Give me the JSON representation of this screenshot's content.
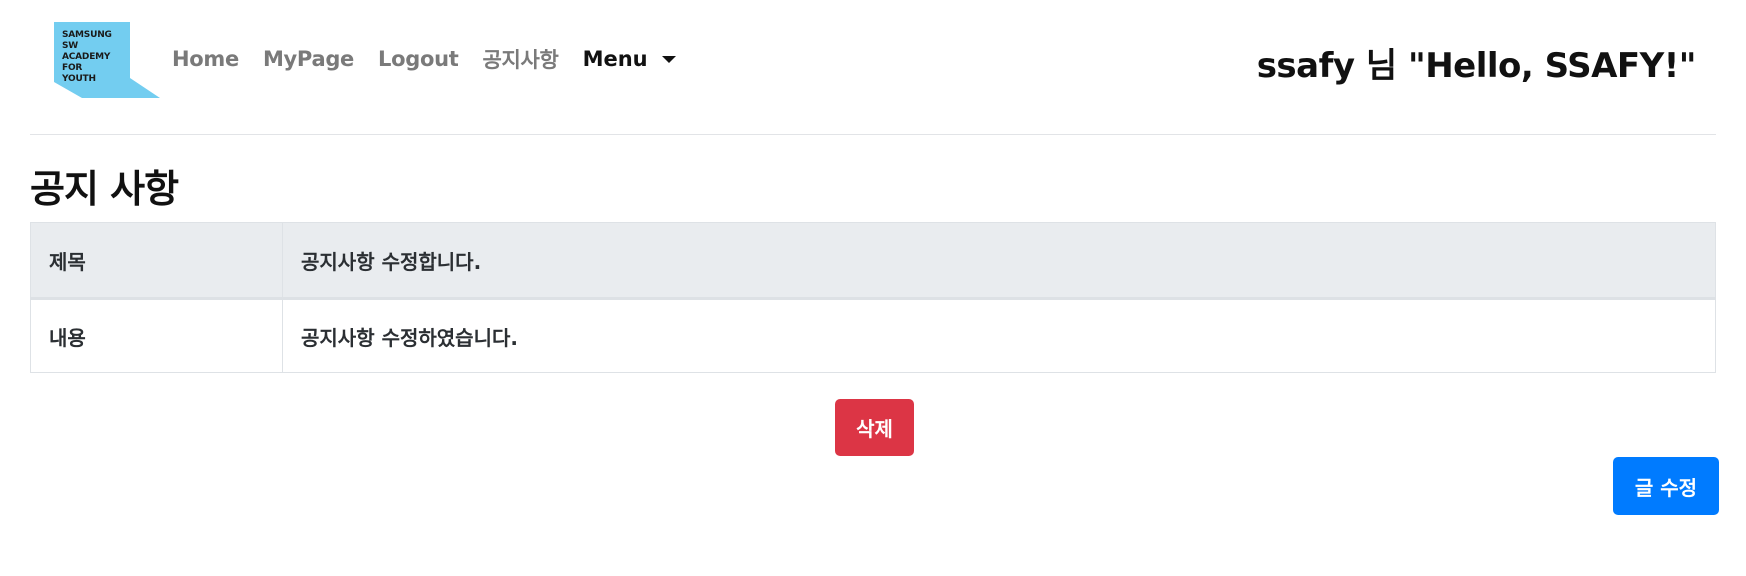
{
  "logo": {
    "lines": [
      "SAMSUNG",
      "SW",
      "ACADEMY",
      "FOR",
      "YOUTH"
    ],
    "color": "#73cdf0"
  },
  "nav": {
    "links": [
      "Home",
      "MyPage",
      "Logout",
      "공지사항"
    ],
    "dropdown_label": "Menu"
  },
  "greeting": "ssafy 님 \"Hello, SSAFY!\"",
  "page_title": "공지 사항",
  "notice": {
    "title_label": "제목",
    "title_value": "공지사항 수정합니다.",
    "content_label": "내용",
    "content_value": "공지사항 수정하였습니다."
  },
  "buttons": {
    "delete_label": "삭제",
    "edit_label": "글 수정"
  },
  "colors": {
    "danger": "#dc3545",
    "primary": "#007bff",
    "table_header_bg": "#e9ecef",
    "nav_link": "#7a7a7a"
  }
}
